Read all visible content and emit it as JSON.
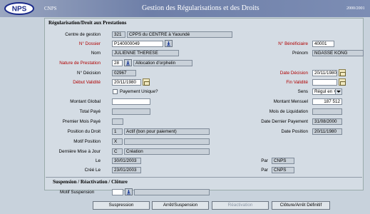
{
  "app": {
    "logo_text": "NPS",
    "name": "CNPS",
    "title": "Gestion des Régularisations et des Droits",
    "year": "2000/2001"
  },
  "sections": {
    "main": "Régularisation/Droit aux Prestations",
    "suspension": "Suspension / Réactivation / Clôture"
  },
  "labels": {
    "centre": "Centre de gestion",
    "dossier": "N° Dossier",
    "beneficiaire": "N° Bénéficiaire",
    "nom": "Nom",
    "prenom": "Prénom",
    "nature": "Nature de Prestation",
    "decision": "N° Décision",
    "date_decision": "Date Décision",
    "debut": "Début Validité",
    "fin": "Fin Validité",
    "sens": "Sens",
    "paiement_unique": "Payement Unique?",
    "montant_global": "Montant Global",
    "montant_mensuel": "Montant Mensuel",
    "total_paye": "Total Payé",
    "mois_liquidation": "Mois de Liquidation",
    "premier_mois": "Premier Mois Payé",
    "date_dernier": "Date Dernier Payement",
    "position_droit": "Position du Droit",
    "date_position": "Date Position",
    "motif_position": "Motif Position",
    "derniere_maj": "Dernière Mise à Jour",
    "le": "Le",
    "cree_le": "Créé Le",
    "par1": "Par",
    "par2": "Par",
    "motif_suspension": "Motif Suspension"
  },
  "values": {
    "centre_code": "321",
    "centre_name": "CPPS du CENTRE à Yaoundé",
    "dossier": "P140000049",
    "beneficiaire": "40001",
    "nom": "JULIENNE THERESE",
    "prenom": "NGASSE KONG",
    "nature_code": "28",
    "nature_name": "Allocation d'orphelin",
    "decision": "02967",
    "date_decision": "20/11/1980",
    "debut": "20/11/1980",
    "fin": "",
    "sens": "Régul en +",
    "montant_global": "",
    "montant_mensuel": "187 512",
    "total_paye": "",
    "mois_liquidation": "",
    "premier_mois": "",
    "date_dernier": "31/08/2000",
    "position_code": "1",
    "position_name": "Actif (bon pour paiement)",
    "date_position": "20/11/1980",
    "motif_code": "X",
    "motif_name": "",
    "maj_code": "C",
    "maj_name": "Création",
    "le": "30/01/2003",
    "cree_le": "23/01/2003",
    "par1": "CNPS",
    "par2": "CNPS",
    "motif_suspension_code": "",
    "motif_suspension_name": ""
  },
  "buttons": {
    "suspension": "Suspression",
    "arret": "Arrêt/Suspension",
    "reactivation": "Réactivation",
    "cloture": "Clôture/Arrêt Définitif"
  },
  "colors": {
    "title_bar": "#6e7fa8",
    "panel": "#d4dce4",
    "required_label": "#b00000"
  }
}
